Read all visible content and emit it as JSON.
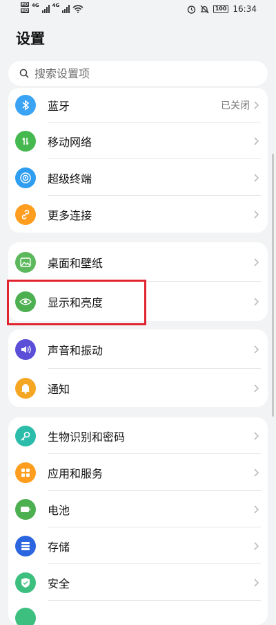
{
  "status": {
    "left": [
      "HD",
      "HD"
    ],
    "net": "4G",
    "net2": "4G",
    "battery": "100",
    "time": "16:34"
  },
  "title": "设置",
  "search": {
    "placeholder": "搜索设置项"
  },
  "groups": [
    {
      "items": [
        {
          "label": "蓝牙",
          "value": "已关闭",
          "icon": "bluetooth-icon",
          "color": "#3aa3f4"
        },
        {
          "label": "移动网络",
          "icon": "mobile-data-icon",
          "color": "#45b84f"
        },
        {
          "label": "超级终端",
          "icon": "super-device-icon",
          "color": "#2f9ef0"
        },
        {
          "label": "更多连接",
          "icon": "link-icon",
          "color": "#ff9d1f"
        }
      ]
    },
    {
      "items": [
        {
          "label": "桌面和壁纸",
          "icon": "wallpaper-icon",
          "color": "#5cb85c"
        },
        {
          "label": "显示和亮度",
          "icon": "eye-icon",
          "color": "#4caf50"
        }
      ]
    },
    {
      "items": [
        {
          "label": "声音和振动",
          "icon": "sound-icon",
          "color": "#5b4fd8"
        },
        {
          "label": "通知",
          "icon": "bell-icon",
          "color": "#f5a623"
        }
      ]
    },
    {
      "items": [
        {
          "label": "生物识别和密码",
          "icon": "key-icon",
          "color": "#2bbcaa"
        },
        {
          "label": "应用和服务",
          "icon": "apps-icon",
          "color": "#ff9d1f"
        },
        {
          "label": "电池",
          "icon": "battery-icon",
          "color": "#4caf50"
        },
        {
          "label": "存储",
          "icon": "storage-icon",
          "color": "#2b66e0"
        },
        {
          "label": "安全",
          "icon": "shield-icon",
          "color": "#3cbf7f"
        }
      ]
    }
  ]
}
